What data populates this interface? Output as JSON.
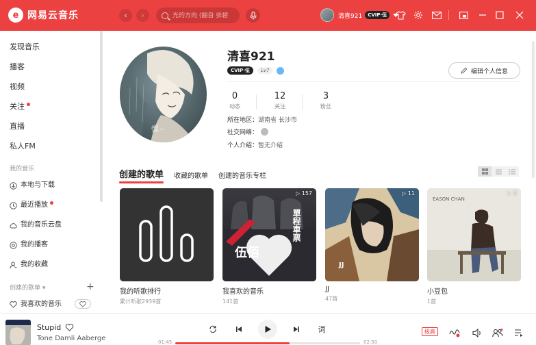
{
  "app": {
    "logo_glyph": "e",
    "name": "网易云音乐",
    "accent": "#ec4141"
  },
  "topbar": {
    "back_icon": "chevron-left-icon",
    "forward_icon": "chevron-right-icon",
    "search_placeholder": "光的方向 (翻自 张碧",
    "user_name": "清喜921",
    "vip_label": "CVIP·伍"
  },
  "sidebar": {
    "items": [
      {
        "label": "发现音乐"
      },
      {
        "label": "播客"
      },
      {
        "label": "视频"
      },
      {
        "label": "关注",
        "dot": true
      },
      {
        "label": "直播"
      },
      {
        "label": "私人FM"
      }
    ],
    "section_my_music": "我的音乐",
    "my_items": [
      {
        "label": "本地与下载",
        "icon": "download-icon"
      },
      {
        "label": "最近播放",
        "icon": "clock-icon",
        "dot": true
      },
      {
        "label": "我的音乐云盘",
        "icon": "cloud-icon"
      },
      {
        "label": "我的播客",
        "icon": "podcast-icon"
      },
      {
        "label": "我的收藏",
        "icon": "person-icon"
      }
    ],
    "section_created": "创建的歌单",
    "created_caret": "▾",
    "add_label": "+",
    "playlist_item": "我喜欢的音乐"
  },
  "profile": {
    "name": "清喜921",
    "vip_badge": "CVIP·伍",
    "level": "Lv7",
    "edit_label": "编辑个人信息",
    "stats": [
      {
        "num": "0",
        "label": "动态"
      },
      {
        "num": "12",
        "label": "关注"
      },
      {
        "num": "3",
        "label": "粉丝"
      }
    ],
    "region_label": "所在地区：",
    "region_value": "湖南省 长沙市",
    "social_label": "社交网络：",
    "intro_label": "个人介绍：",
    "intro_value": "暂无介绍",
    "avatar_caption": "惺~"
  },
  "tabs": [
    {
      "label": "创建的歌单",
      "active": true
    },
    {
      "label": "收藏的歌单",
      "active": false
    },
    {
      "label": "创建的音乐专栏",
      "active": false
    }
  ],
  "playlists": [
    {
      "title": "我的听歌排行",
      "sub": "累计听歌2939首",
      "count": ""
    },
    {
      "title": "我喜欢的音乐",
      "sub": "141首",
      "count": "▷ 157",
      "cover_text": "伍佰",
      "cover_text2": "單程車票"
    },
    {
      "title": "JJ",
      "sub": "47首",
      "count": "▷ 11",
      "cover_text": "JJ"
    },
    {
      "title": "小豆包",
      "sub": "1首",
      "count": "▷ 0",
      "cover_text": "EASON CHAN"
    }
  ],
  "player": {
    "song": "Stupid",
    "artist": "Tone Damli Aaberge",
    "elapsed": "01:45",
    "total": "02:50",
    "progress": 0.62,
    "quality": "极高",
    "lyric_label": "词"
  }
}
